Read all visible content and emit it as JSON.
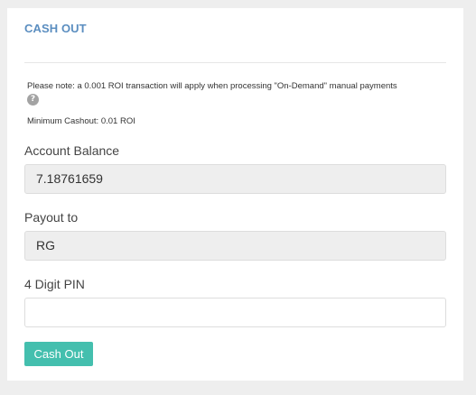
{
  "panel": {
    "title": "CASH OUT",
    "note": "Please note: a 0.001 ROI transaction will apply when processing \"On-Demand\" manual payments",
    "info_icon_glyph": "?",
    "min_cashout": "Minimum Cashout: 0.01 ROI"
  },
  "form": {
    "account_balance": {
      "label": "Account Balance",
      "value": "7.18761659"
    },
    "payout_to": {
      "label": "Payout to",
      "value": "RG"
    },
    "pin": {
      "label": "4 Digit PIN",
      "value": "",
      "placeholder": ""
    },
    "submit_label": "Cash Out"
  },
  "colors": {
    "title": "#5b8ec0",
    "button": "#44bfae",
    "readonly_bg": "#eeeeee",
    "page_bg": "#eeeeee"
  },
  "icons": {
    "info": "question-circle-icon"
  }
}
